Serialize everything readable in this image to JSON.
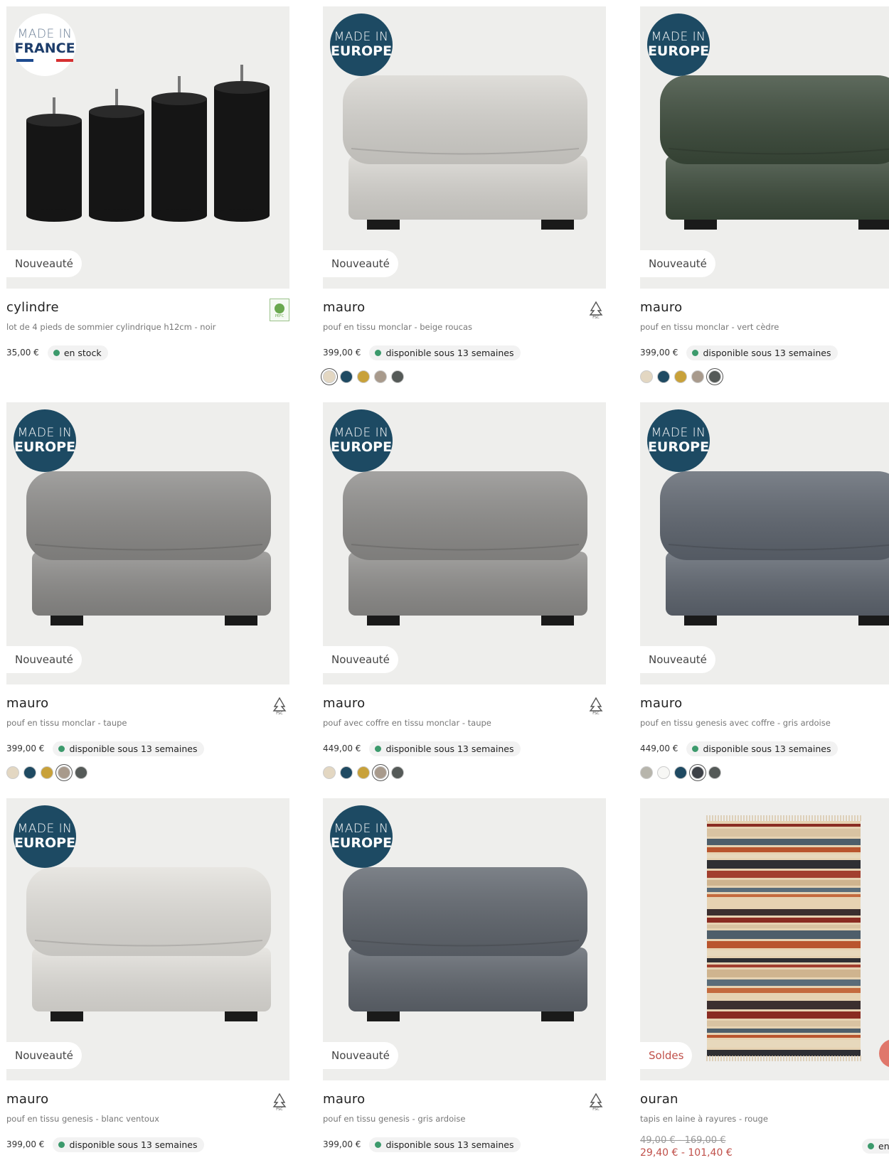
{
  "cards": [
    {
      "badge_l1": "MADE IN",
      "badge_l2": "FRANCE",
      "badge_type": "france",
      "tag": "Nouveauté",
      "title": "cylindre",
      "desc": "lot de 4 pieds de sommier cylindrique h12cm - noir",
      "price": "35,00 €",
      "stock": "en stock",
      "eco": "PEFC",
      "swatches": []
    },
    {
      "badge_l1": "MADE IN",
      "badge_l2": "EUROPE",
      "badge_type": "europe",
      "tag": "Nouveauté",
      "title": "mauro",
      "desc": "pouf en tissu monclar - beige roucas",
      "price": "399,00 €",
      "stock": "disponible sous 13 semaines",
      "eco": "FSC",
      "product_color": "#d8d6d1",
      "swatches": [
        "#e3d7c2",
        "#1f4a62",
        "#c8a13a",
        "#a89a8c",
        "#555a58"
      ],
      "selected": 0
    },
    {
      "badge_l1": "MADE IN",
      "badge_l2": "EUROPE",
      "badge_type": "europe",
      "tag": "Nouveauté",
      "title": "mauro",
      "desc": "pouf en tissu monclar - vert cèdre",
      "price": "399,00 €",
      "stock": "disponible sous 13 semaines",
      "eco": "",
      "product_color": "#3b4a3a",
      "swatches": [
        "#e3d7c2",
        "#1f4a62",
        "#c8a13a",
        "#a89a8c",
        "#555a58"
      ],
      "selected": 4
    },
    {
      "badge_l1": "MADE IN",
      "badge_l2": "EUROPE",
      "badge_type": "europe",
      "tag": "Nouveauté",
      "title": "mauro",
      "desc": "pouf en tissu monclar - taupe",
      "price": "399,00 €",
      "stock": "disponible sous 13 semaines",
      "eco": "FSC",
      "product_color": "#8d8c8a",
      "swatches": [
        "#e3d7c2",
        "#1f4a62",
        "#c8a13a",
        "#a89a8c",
        "#555a58"
      ],
      "selected": 3
    },
    {
      "badge_l1": "MADE IN",
      "badge_l2": "EUROPE",
      "badge_type": "europe",
      "tag": "Nouveauté",
      "title": "mauro",
      "desc": "pouf avec coffre en tissu monclar - taupe",
      "price": "449,00 €",
      "stock": "disponible sous 13 semaines",
      "eco": "FSC",
      "product_color": "#8f8e8c",
      "swatches": [
        "#e3d7c2",
        "#1f4a62",
        "#c8a13a",
        "#a89a8c",
        "#555a58"
      ],
      "selected": 3
    },
    {
      "badge_l1": "MADE IN",
      "badge_l2": "EUROPE",
      "badge_type": "europe",
      "tag": "Nouveauté",
      "title": "mauro",
      "desc": "pouf en tissu genesis avec coffre - gris ardoise",
      "price": "449,00 €",
      "stock": "disponible sous 13 semaines",
      "eco": "",
      "product_color": "#5f6670",
      "swatches": [
        "#b7b5ac",
        "#f7f7f5",
        "#1f4a62",
        "#3d4147",
        "#555a58"
      ],
      "selected": 3
    },
    {
      "badge_l1": "MADE IN",
      "badge_l2": "EUROPE",
      "badge_type": "europe",
      "tag": "Nouveauté",
      "title": "mauro",
      "desc": "pouf en tissu genesis - blanc ventoux",
      "price": "399,00 €",
      "stock": "disponible sous 13 semaines",
      "eco": "FSC",
      "product_color": "#e3e1dc",
      "swatches": []
    },
    {
      "badge_l1": "MADE IN",
      "badge_l2": "EUROPE",
      "badge_type": "europe",
      "tag": "Nouveauté",
      "title": "mauro",
      "desc": "pouf en tissu genesis - gris ardoise",
      "price": "399,00 €",
      "stock": "disponible sous 13 semaines",
      "eco": "FSC",
      "product_color": "#60666e",
      "swatches": []
    },
    {
      "badge_l1": "",
      "badge_l2": "",
      "badge_type": "none",
      "tag": "Soldes",
      "tag_type": "sale",
      "title": "ouran",
      "desc": "tapis en laine à rayures - rouge",
      "price": "",
      "old_price": "49,00 € - 169,00 €",
      "new_price": "29,40 € - 101,40 €",
      "stock": "en",
      "eco": "",
      "product": "rug",
      "swatches": []
    }
  ]
}
